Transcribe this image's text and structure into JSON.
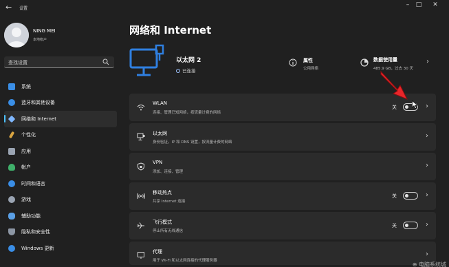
{
  "window": {
    "title": "设置",
    "back_icon": "back-arrow-icon",
    "controls": [
      "minimize-icon",
      "maximize-icon",
      "close-icon"
    ]
  },
  "profile": {
    "name": "NING MEI",
    "subtitle": "本地帐户"
  },
  "search": {
    "placeholder": "查找设置",
    "icon": "search-icon"
  },
  "sidebar": {
    "items": [
      {
        "label": "系统",
        "icon": "monitor-icon",
        "color": "#3a8ee6",
        "active": false
      },
      {
        "label": "蓝牙和其他设备",
        "icon": "bluetooth-icon",
        "color": "#3a8ee6",
        "active": false
      },
      {
        "label": "网络和 Internet",
        "icon": "wifi-diamond-icon",
        "color": "#7fb7ff",
        "active": true
      },
      {
        "label": "个性化",
        "icon": "brush-icon",
        "color": "#d9a441",
        "active": false
      },
      {
        "label": "应用",
        "icon": "apps-icon",
        "color": "#9aa4b2",
        "active": false
      },
      {
        "label": "帐户",
        "icon": "account-icon",
        "color": "#3fb06a",
        "active": false
      },
      {
        "label": "时间和语言",
        "icon": "globe-clock-icon",
        "color": "#3a8ee6",
        "active": false
      },
      {
        "label": "游戏",
        "icon": "gamepad-icon",
        "color": "#9aa4b2",
        "active": false
      },
      {
        "label": "辅助功能",
        "icon": "accessibility-icon",
        "color": "#5aa0e6",
        "active": false
      },
      {
        "label": "隐私和安全性",
        "icon": "shield-icon",
        "color": "#8c96a4",
        "active": false
      },
      {
        "label": "Windows 更新",
        "icon": "update-icon",
        "color": "#3a8ee6",
        "active": false
      }
    ]
  },
  "main": {
    "title": "网络和 Internet",
    "ethernet": {
      "name": "以太网 2",
      "status": "已连接",
      "icon": "ethernet-monitor-icon"
    },
    "properties": {
      "label": "属性",
      "sub": "公用网络",
      "icon": "info-icon"
    },
    "data_usage": {
      "label": "数据使用量",
      "sub": "485.9 GB，过去 30 天",
      "icon": "data-usage-icon"
    },
    "rows": [
      {
        "key": "wlan",
        "title": "WLAN",
        "sub": "连接、管理已知网络，按流量计费的网络",
        "icon": "wifi-icon",
        "toggle": true,
        "toggle_label": "关"
      },
      {
        "key": "ethernet",
        "title": "以太网",
        "sub": "身份验证，IP 和 DNS 设置，按流量计费的网络",
        "icon": "ethernet-icon",
        "toggle": false,
        "toggle_label": ""
      },
      {
        "key": "vpn",
        "title": "VPN",
        "sub": "添加、连接、管理",
        "icon": "vpn-shield-icon",
        "toggle": false,
        "toggle_label": ""
      },
      {
        "key": "hotspot",
        "title": "移动热点",
        "sub": "共享 Internet 连接",
        "icon": "hotspot-icon",
        "toggle": true,
        "toggle_label": "关"
      },
      {
        "key": "airplane",
        "title": "飞行模式",
        "sub": "停止所有无线通信",
        "icon": "airplane-icon",
        "toggle": true,
        "toggle_label": "关"
      },
      {
        "key": "proxy",
        "title": "代理",
        "sub": "用于 Wi-Fi 和以太网连接的代理服务器",
        "icon": "proxy-icon",
        "toggle": false,
        "toggle_label": ""
      }
    ]
  },
  "colors": {
    "background": "#202020",
    "card": "#2b2b2b",
    "accent": "#4cc2ff",
    "ethernet_blue": "#2f7fe0",
    "annotation_red": "#e8262a"
  },
  "watermark": "⊕ 电脑系统城"
}
